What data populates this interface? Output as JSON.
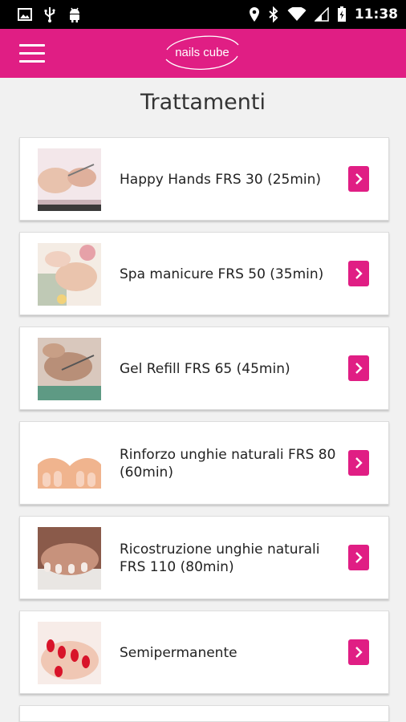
{
  "status_bar": {
    "time": "11:38",
    "left_icons": [
      "image-icon",
      "usb-icon",
      "android-icon"
    ],
    "right_icons": [
      "location-icon",
      "bluetooth-icon",
      "wifi-icon",
      "signal-icon",
      "battery-icon"
    ]
  },
  "app_bar": {
    "logo_text": "nails cube",
    "menu_icon": "hamburger-menu-icon"
  },
  "page": {
    "title": "Trattamenti"
  },
  "treatments": [
    {
      "label": "Happy Hands FRS 30 (25min)",
      "thumb": "manicure-hands-photo"
    },
    {
      "label": "Spa manicure FRS 50 (35min)",
      "thumb": "spa-manicure-photo"
    },
    {
      "label": "Gel Refill FRS 65 (45min)",
      "thumb": "gel-refill-photo"
    },
    {
      "label": "Rinforzo unghie naturali FRS 80 (60min)",
      "thumb": "natural-nails-photo"
    },
    {
      "label": "Ricostruzione unghie naturali FRS 110 (80min)",
      "thumb": "french-nails-photo"
    },
    {
      "label": "Semipermanente",
      "thumb": "red-nails-photo"
    }
  ],
  "colors": {
    "brand": "#e01e84",
    "background": "#f1f1f1",
    "card": "#ffffff"
  }
}
